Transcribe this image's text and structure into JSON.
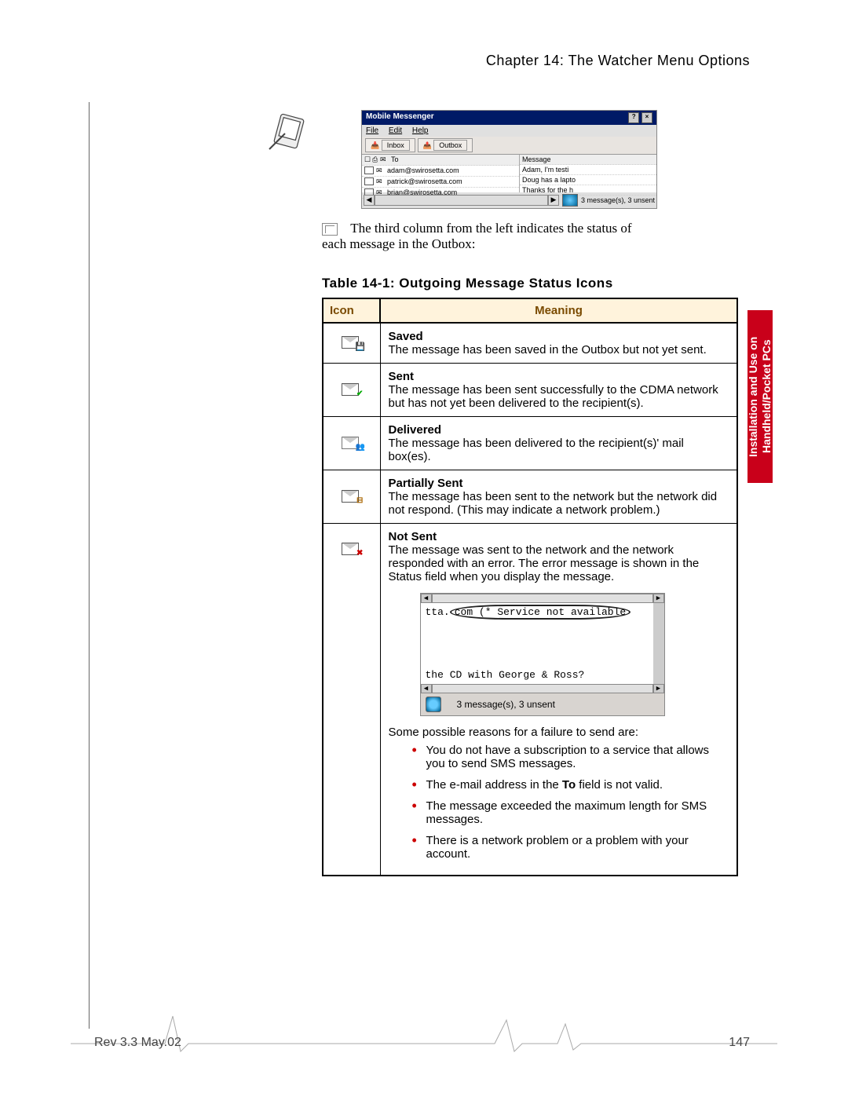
{
  "chapter": "Chapter 14: The Watcher Menu Options",
  "messenger": {
    "title": "Mobile Messenger",
    "menu": {
      "file": "File",
      "edit": "Edit",
      "help": "Help"
    },
    "tabs": {
      "inbox": "Inbox",
      "outbox": "Outbox"
    },
    "headers": {
      "to": "To",
      "message": "Message"
    },
    "rows": [
      {
        "to": "adam@swirosetta.com",
        "msg": "Adam, I'm testi"
      },
      {
        "to": "patrick@swirosetta.com",
        "msg": "Doug has a lapto"
      },
      {
        "to": "brian@swirosetta.com",
        "msg": "Thanks for the h"
      }
    ],
    "status": "3 message(s), 3 unsent"
  },
  "intro_text_a": "The third column from the left indicates the status of",
  "intro_text_b": "each message in the Outbox:",
  "table_caption": "Table 14-1: Outgoing Message Status Icons",
  "table_headers": {
    "icon": "Icon",
    "meaning": "Meaning"
  },
  "rows": {
    "saved": {
      "title": "Saved",
      "body": "The message has been saved in the Outbox but not yet sent."
    },
    "sent": {
      "title": "Sent",
      "body": "The message has been sent successfully to the CDMA network but has not yet been delivered to the recipient(s)."
    },
    "delivered": {
      "title": "Delivered",
      "body": "The message has been delivered to the recipient(s)' mail box(es)."
    },
    "partial": {
      "title": "Partially Sent",
      "body": "The message has been sent to the network but the network did not respond. (This may indicate a network problem.)"
    },
    "notsent": {
      "title": "Not Sent",
      "body": "The message was sent to the network and the network responded with an error. The error message is shown in the Status field when you display the message."
    }
  },
  "error_window": {
    "line1": "tta.com (* Service not available",
    "line2": "the CD with George & Ross?",
    "status": "3 message(s), 3 unsent"
  },
  "reasons_intro": "Some possible reasons for a failure to send are:",
  "reasons": [
    "You do not have a subscription to a service that allows you to send SMS messages.",
    "The e-mail address in the To field is not valid.",
    "The message exceeded the maximum length for SMS messages.",
    "There is a network problem or a problem with your account."
  ],
  "reason_to_bold": "To",
  "side_tab_line1": "Installation and Use on",
  "side_tab_line2": "Handheld/Pocket PCs",
  "footer": {
    "rev": "Rev 3.3  May.02",
    "page": "147"
  }
}
